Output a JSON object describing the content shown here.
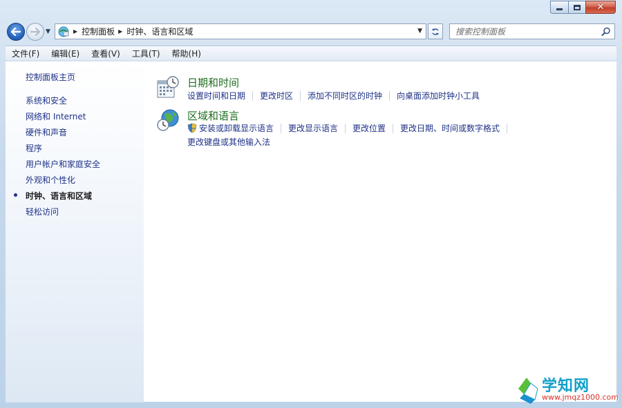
{
  "window": {
    "minimize_label": "minimize",
    "maximize_label": "maximize",
    "close_label": "close"
  },
  "address_bar": {
    "crumbs": [
      "控制面板",
      "时钟、语言和区域"
    ]
  },
  "search": {
    "placeholder": "搜索控制面板"
  },
  "menu": {
    "items": [
      "文件(F)",
      "编辑(E)",
      "查看(V)",
      "工具(T)",
      "帮助(H)"
    ]
  },
  "sidebar": {
    "home": "控制面板主页",
    "items": [
      {
        "label": "系统和安全",
        "active": false
      },
      {
        "label": "网络和 Internet",
        "active": false
      },
      {
        "label": "硬件和声音",
        "active": false
      },
      {
        "label": "程序",
        "active": false
      },
      {
        "label": "用户帐户和家庭安全",
        "active": false
      },
      {
        "label": "外观和个性化",
        "active": false
      },
      {
        "label": "时钟、语言和区域",
        "active": true
      },
      {
        "label": "轻松访问",
        "active": false
      }
    ]
  },
  "categories": [
    {
      "title": "日期和时间",
      "icon": "calendar-clock-icon",
      "tasks": [
        "设置时间和日期",
        "更改时区",
        "添加不同时区的时钟",
        "向桌面添加时钟小工具"
      ]
    },
    {
      "title": "区域和语言",
      "icon": "globe-clock-icon",
      "tasks": [
        "安装或卸载显示语言",
        "更改显示语言",
        "更改位置",
        "更改日期、时间或数字格式"
      ],
      "tasks_row2": [
        "更改键盘或其他输入法"
      ]
    }
  ],
  "watermark": {
    "title": "学知网",
    "url": "www.jmqz1000.com"
  },
  "colors": {
    "link": "#1e3287",
    "category_title": "#1e6d1e",
    "frame": "#c6d9ec"
  }
}
